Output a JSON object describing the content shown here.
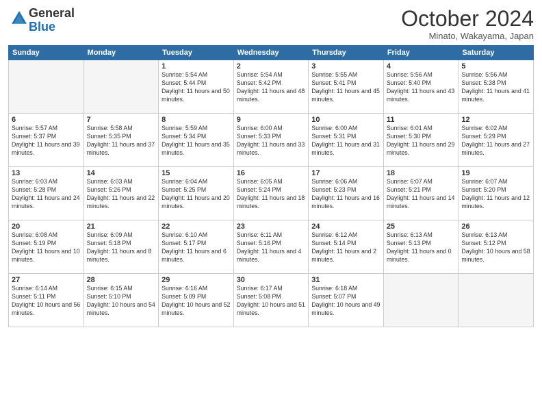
{
  "header": {
    "logo_line1": "General",
    "logo_line2": "Blue",
    "month": "October 2024",
    "location": "Minato, Wakayama, Japan"
  },
  "weekdays": [
    "Sunday",
    "Monday",
    "Tuesday",
    "Wednesday",
    "Thursday",
    "Friday",
    "Saturday"
  ],
  "weeks": [
    [
      {
        "day": "",
        "empty": true
      },
      {
        "day": "",
        "empty": true
      },
      {
        "day": "1",
        "sunrise": "5:54 AM",
        "sunset": "5:44 PM",
        "daylight": "11 hours and 50 minutes."
      },
      {
        "day": "2",
        "sunrise": "5:54 AM",
        "sunset": "5:42 PM",
        "daylight": "11 hours and 48 minutes."
      },
      {
        "day": "3",
        "sunrise": "5:55 AM",
        "sunset": "5:41 PM",
        "daylight": "11 hours and 45 minutes."
      },
      {
        "day": "4",
        "sunrise": "5:56 AM",
        "sunset": "5:40 PM",
        "daylight": "11 hours and 43 minutes."
      },
      {
        "day": "5",
        "sunrise": "5:56 AM",
        "sunset": "5:38 PM",
        "daylight": "11 hours and 41 minutes."
      }
    ],
    [
      {
        "day": "6",
        "sunrise": "5:57 AM",
        "sunset": "5:37 PM",
        "daylight": "11 hours and 39 minutes."
      },
      {
        "day": "7",
        "sunrise": "5:58 AM",
        "sunset": "5:35 PM",
        "daylight": "11 hours and 37 minutes."
      },
      {
        "day": "8",
        "sunrise": "5:59 AM",
        "sunset": "5:34 PM",
        "daylight": "11 hours and 35 minutes."
      },
      {
        "day": "9",
        "sunrise": "6:00 AM",
        "sunset": "5:33 PM",
        "daylight": "11 hours and 33 minutes."
      },
      {
        "day": "10",
        "sunrise": "6:00 AM",
        "sunset": "5:31 PM",
        "daylight": "11 hours and 31 minutes."
      },
      {
        "day": "11",
        "sunrise": "6:01 AM",
        "sunset": "5:30 PM",
        "daylight": "11 hours and 29 minutes."
      },
      {
        "day": "12",
        "sunrise": "6:02 AM",
        "sunset": "5:29 PM",
        "daylight": "11 hours and 27 minutes."
      }
    ],
    [
      {
        "day": "13",
        "sunrise": "6:03 AM",
        "sunset": "5:28 PM",
        "daylight": "11 hours and 24 minutes."
      },
      {
        "day": "14",
        "sunrise": "6:03 AM",
        "sunset": "5:26 PM",
        "daylight": "11 hours and 22 minutes."
      },
      {
        "day": "15",
        "sunrise": "6:04 AM",
        "sunset": "5:25 PM",
        "daylight": "11 hours and 20 minutes."
      },
      {
        "day": "16",
        "sunrise": "6:05 AM",
        "sunset": "5:24 PM",
        "daylight": "11 hours and 18 minutes."
      },
      {
        "day": "17",
        "sunrise": "6:06 AM",
        "sunset": "5:23 PM",
        "daylight": "11 hours and 16 minutes."
      },
      {
        "day": "18",
        "sunrise": "6:07 AM",
        "sunset": "5:21 PM",
        "daylight": "11 hours and 14 minutes."
      },
      {
        "day": "19",
        "sunrise": "6:07 AM",
        "sunset": "5:20 PM",
        "daylight": "11 hours and 12 minutes."
      }
    ],
    [
      {
        "day": "20",
        "sunrise": "6:08 AM",
        "sunset": "5:19 PM",
        "daylight": "11 hours and 10 minutes."
      },
      {
        "day": "21",
        "sunrise": "6:09 AM",
        "sunset": "5:18 PM",
        "daylight": "11 hours and 8 minutes."
      },
      {
        "day": "22",
        "sunrise": "6:10 AM",
        "sunset": "5:17 PM",
        "daylight": "11 hours and 6 minutes."
      },
      {
        "day": "23",
        "sunrise": "6:11 AM",
        "sunset": "5:16 PM",
        "daylight": "11 hours and 4 minutes."
      },
      {
        "day": "24",
        "sunrise": "6:12 AM",
        "sunset": "5:14 PM",
        "daylight": "11 hours and 2 minutes."
      },
      {
        "day": "25",
        "sunrise": "6:13 AM",
        "sunset": "5:13 PM",
        "daylight": "11 hours and 0 minutes."
      },
      {
        "day": "26",
        "sunrise": "6:13 AM",
        "sunset": "5:12 PM",
        "daylight": "10 hours and 58 minutes."
      }
    ],
    [
      {
        "day": "27",
        "sunrise": "6:14 AM",
        "sunset": "5:11 PM",
        "daylight": "10 hours and 56 minutes."
      },
      {
        "day": "28",
        "sunrise": "6:15 AM",
        "sunset": "5:10 PM",
        "daylight": "10 hours and 54 minutes."
      },
      {
        "day": "29",
        "sunrise": "6:16 AM",
        "sunset": "5:09 PM",
        "daylight": "10 hours and 52 minutes."
      },
      {
        "day": "30",
        "sunrise": "6:17 AM",
        "sunset": "5:08 PM",
        "daylight": "10 hours and 51 minutes."
      },
      {
        "day": "31",
        "sunrise": "6:18 AM",
        "sunset": "5:07 PM",
        "daylight": "10 hours and 49 minutes."
      },
      {
        "day": "",
        "empty": true
      },
      {
        "day": "",
        "empty": true
      }
    ]
  ]
}
